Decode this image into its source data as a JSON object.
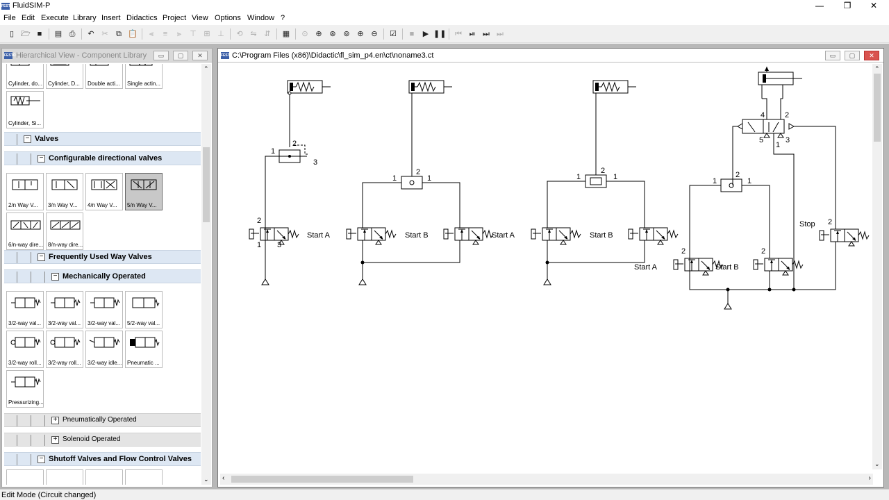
{
  "app": {
    "title": "FluidSIM-P"
  },
  "window_controls": {
    "minimize": "—",
    "maximize": "❐",
    "close": "✕"
  },
  "menu": [
    "File",
    "Edit",
    "Execute",
    "Library",
    "Insert",
    "Didactics",
    "Project",
    "View",
    "Options",
    "Window",
    "?"
  ],
  "library": {
    "title": "Hierarchical View - Component Library",
    "cylinder_tiles": [
      "Cylinder, do...",
      "Cylinder, D...",
      "Double acti...",
      "Single actin...",
      "Cylinder, Si..."
    ],
    "group_valves": "Valves",
    "group_configurable": "Configurable directional valves",
    "config_tiles": [
      "2/n Way V...",
      "3/n Way V...",
      "4/n Way V...",
      "5/n Way V...",
      "6/n-way dire...",
      "8/n-way dire..."
    ],
    "group_frequent": "Frequently Used Way Valves",
    "group_mech": "Mechanically Operated",
    "mech_tiles": [
      "3/2-way val...",
      "3/2-way val...",
      "3/2-way val...",
      "5/2-way val...",
      "3/2-way roll...",
      "3/2-way roll...",
      "3/2-way idle...",
      "Pneumatic ...",
      "Pressurizing..."
    ],
    "group_pneu": "Pneumatically Operated",
    "group_solenoid": "Solenoid Operated",
    "group_shutoff": "Shutoff Valves and Flow Control Valves"
  },
  "circuit": {
    "title": "C:\\Program Files (x86)\\Didactic\\fl_sim_p4.en\\ct\\noname3.ct",
    "labels": {
      "start_a": "Start  A",
      "start_b": "Start  B",
      "stop": "Stop"
    },
    "port_labels": {
      "p1": "1",
      "p2": "2",
      "p3": "3",
      "p4": "4",
      "p5": "5"
    }
  },
  "status": {
    "text": "Edit Mode (Circuit changed)"
  }
}
